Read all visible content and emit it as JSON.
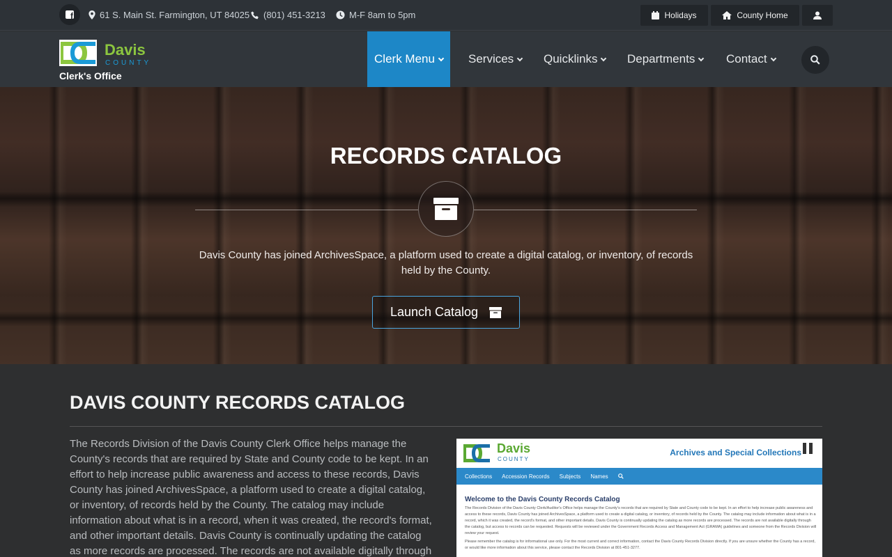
{
  "topbar": {
    "facebook_icon": "facebook-icon",
    "address": "61 S. Main St. Farmington, UT 84025",
    "phone": "(801) 451-3213",
    "hours": "M-F 8am to 5pm",
    "holidays_label": "Holidays",
    "county_home_label": "County Home",
    "user_icon": "user-icon"
  },
  "logo": {
    "name": "Davis",
    "county": "COUNTY",
    "office": "Clerk's Office"
  },
  "nav": {
    "items": [
      {
        "label": "Clerk Menu",
        "active": true
      },
      {
        "label": "Services",
        "active": false
      },
      {
        "label": "Quicklinks",
        "active": false
      },
      {
        "label": "Departments",
        "active": false
      },
      {
        "label": "Contact",
        "active": false
      }
    ],
    "search_icon": "search-icon"
  },
  "hero": {
    "title": "RECORDS CATALOG",
    "icon": "archive-icon",
    "text": "Davis County has joined ArchivesSpace, a platform used to create a digital catalog, or inventory, of records held by the County.",
    "button_label": "Launch Catalog"
  },
  "main": {
    "title_light": "DAVIS COUNTY ",
    "title_bold": "RECORDS CATALOG",
    "paragraph": "The Records Division of the Davis County Clerk Office helps manage the County's records that are required by State and County code to be kept. In an effort to help increase public awareness and access to these records, Davis County has joined ArchivesSpace, a platform used to create a digital catalog, or inventory, of records held by the County. The catalog may include information about what is in a record, when it was created, the record's format, and other important details. Davis County is continually updating the catalog as more records are processed. The records are not available digitally through the"
  },
  "screenshot": {
    "name": "Davis",
    "county": "COUNTY",
    "heading": "Archives and Special Collections",
    "nav": [
      "Collections",
      "Accession Records",
      "Subjects",
      "Names"
    ],
    "welcome": "Welcome to the Davis County Records Catalog",
    "text": "The Records Division of the Davis County Clerk/Auditor's Office helps manage the County's records that are required by State and County code to be kept. In an effort to help increase public awareness and access to these records, Davis County has joined ArchivesSpace, a platform used to create a digital catalog, or inventory, of records held by the County. The catalog may include information about what is in a record, which it was created, the record's format, and other important details. Davis County is continually updating the catalog as more records are processed. The records are not available digitally through the catalog, but access to records can be requested. Requests will be reviewed under the Government Records Access and Management Act (GRAMA) guidelines and someone from the Records Division will review your request.",
    "text2": "Please remember the catalog is for informational use only. For the most current and correct information, contact the Davis County Records Division directly. If you are unsure whether the County has a record, or would like more information about this service, please contact the Records Division at 801-451-3277."
  },
  "colors": {
    "accent_blue": "#1d87c7",
    "logo_green": "#8cc63f",
    "topbar_bg": "#2d3237",
    "nav_bg": "#31363b"
  }
}
